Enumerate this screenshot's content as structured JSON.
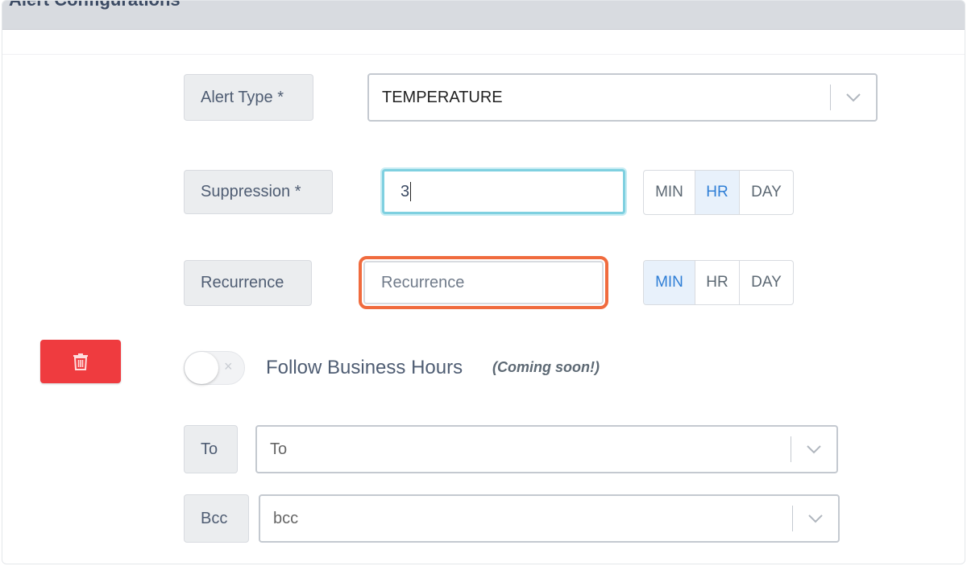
{
  "panel": {
    "title": "Alert Configurations"
  },
  "alert_type": {
    "label": "Alert Type *",
    "value": "TEMPERATURE"
  },
  "suppression": {
    "label": "Suppression *",
    "value": "3",
    "units": [
      "MIN",
      "HR",
      "DAY"
    ],
    "selected_unit": "HR"
  },
  "recurrence": {
    "label": "Recurrence",
    "placeholder": "Recurrence",
    "units": [
      "MIN",
      "HR",
      "DAY"
    ],
    "selected_unit": "MIN"
  },
  "delete_button": {
    "icon": "trash-icon",
    "color": "#ef3b3f"
  },
  "business_hours": {
    "label": "Follow Business Hours",
    "note": "(Coming soon!)",
    "enabled": false,
    "off_glyph": "×"
  },
  "to": {
    "label": "To",
    "placeholder": "To"
  },
  "bcc": {
    "label": "Bcc",
    "placeholder": "bcc"
  },
  "colors": {
    "focus_ring": "#7fd0e0",
    "highlight": "#f06b3e",
    "active_unit": "#2e7ed6",
    "danger": "#ef3b3f"
  }
}
